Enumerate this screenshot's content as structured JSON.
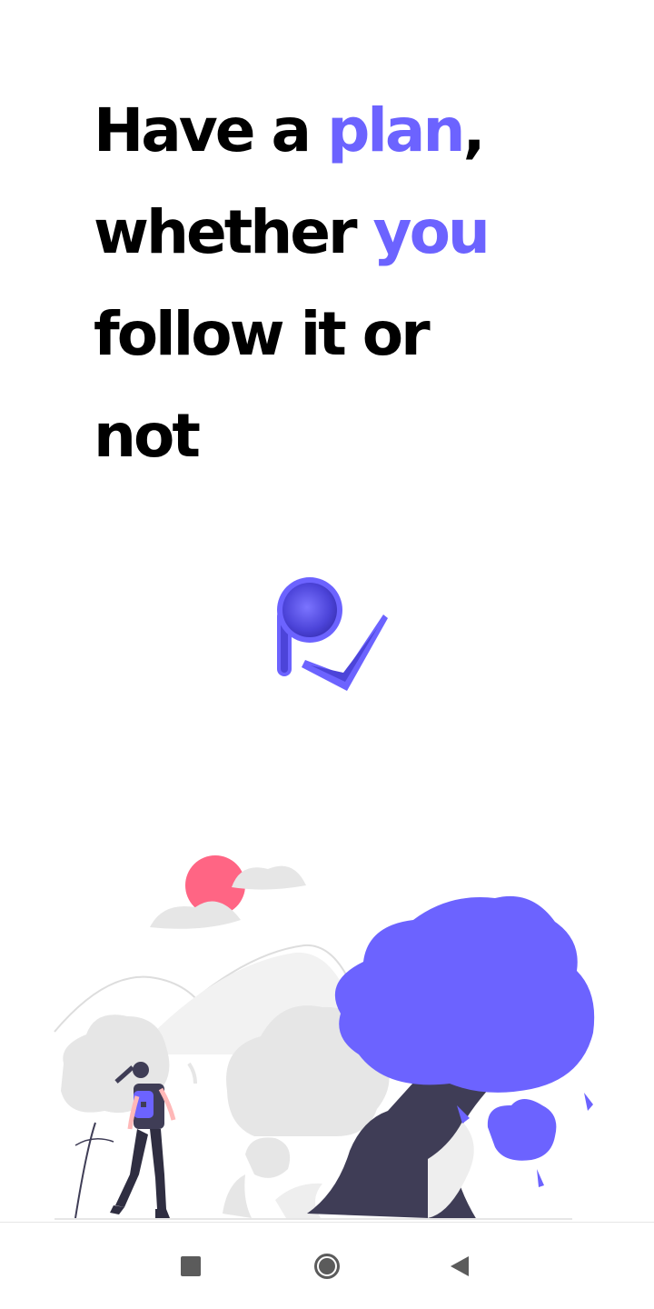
{
  "headline": {
    "line1_prefix": "Have a ",
    "line1_accent": "plan",
    "line1_suffix": ",",
    "line2_prefix": "whether ",
    "line2_accent": "you",
    "line3": "follow it or",
    "line4": "not"
  },
  "colors": {
    "accent": "#6c63ff",
    "text": "#000000",
    "sun": "#ff6584",
    "tree_trunk": "#3f3d56",
    "light_gray": "#e6e6e6",
    "nav_icon": "#5b5b5b"
  },
  "logo": {
    "icon": "pin-check-logo-icon"
  },
  "illustration": {
    "icon": "hiker-forest-illustration"
  },
  "nav": {
    "recents_icon": "square-icon",
    "home_icon": "circle-icon",
    "back_icon": "triangle-back-icon"
  }
}
